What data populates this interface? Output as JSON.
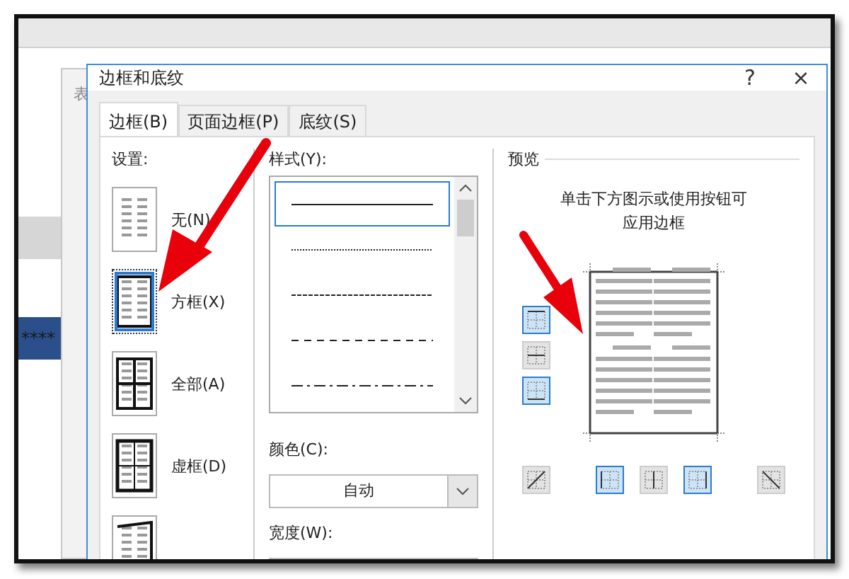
{
  "background": {
    "window_title": "表",
    "highlighted_text": "****"
  },
  "dialog": {
    "title": "边框和底纹",
    "help": "?",
    "close": "×"
  },
  "tabs": [
    {
      "label": "边框(B)",
      "selected": true
    },
    {
      "label": "页面边框(P)",
      "selected": false
    },
    {
      "label": "底纹(S)",
      "selected": false
    }
  ],
  "settings": {
    "label": "设置:",
    "items": [
      {
        "label": "无(N)",
        "kind": "none",
        "selected": false
      },
      {
        "label": "方框(X)",
        "kind": "box",
        "selected": true
      },
      {
        "label": "全部(A)",
        "kind": "all",
        "selected": false
      },
      {
        "label": "虚框(D)",
        "kind": "grid",
        "selected": false
      },
      {
        "kind": "custom",
        "selected": false
      }
    ]
  },
  "style": {
    "label": "样式(Y):",
    "lines": [
      {
        "kind": "solid",
        "selected": true
      },
      {
        "kind": "dotted",
        "selected": false
      },
      {
        "kind": "dashed",
        "selected": false
      },
      {
        "kind": "dash",
        "selected": false
      },
      {
        "kind": "dashdot",
        "selected": false
      }
    ]
  },
  "color": {
    "label": "颜色(C):",
    "value": "自动"
  },
  "width": {
    "label": "宽度(W):"
  },
  "preview": {
    "label": "预览",
    "hint_lines": [
      "单击下方图示或使用按钮可",
      "应用边框"
    ],
    "side_buttons": [
      {
        "kind": "top",
        "on": true
      },
      {
        "kind": "middle",
        "on": false
      },
      {
        "kind": "bottom",
        "on": true
      }
    ],
    "bottom_buttons": [
      {
        "kind": "diag-up",
        "on": false
      },
      {
        "kind": "left",
        "on": true
      },
      {
        "kind": "center",
        "on": false
      },
      {
        "kind": "right",
        "on": true
      },
      {
        "kind": "diag-down",
        "on": false
      }
    ]
  }
}
